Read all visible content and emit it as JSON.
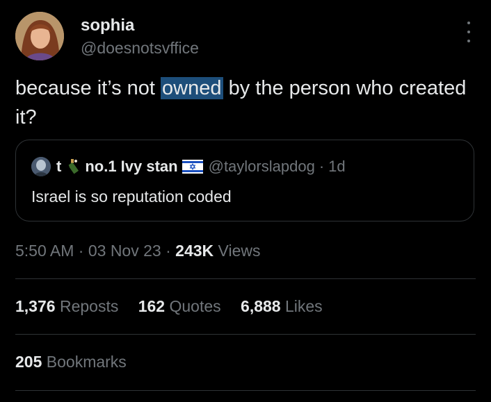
{
  "author": {
    "display_name": "sophia",
    "handle": "@doesnotsvffice"
  },
  "tweet": {
    "text_before": "because it’s not ",
    "text_highlight": "owned",
    "text_after": " by the person who created it?"
  },
  "quote": {
    "name_t": "t",
    "name_rest": "no.1 Ivy stan",
    "handle": "@taylorslapdog",
    "separator": "·",
    "time": "1d",
    "text": "Israel is so reputation coded"
  },
  "meta": {
    "time": "5:50 AM",
    "dot1": "·",
    "date": "03 Nov 23",
    "dot2": "·",
    "views_count": "243K",
    "views_label": "Views"
  },
  "stats": [
    {
      "count": "1,376",
      "label": "Reposts"
    },
    {
      "count": "162",
      "label": "Quotes"
    },
    {
      "count": "6,888",
      "label": "Likes"
    }
  ],
  "bookmarks": {
    "count": "205",
    "label": "Bookmarks"
  },
  "colors": {
    "background": "#000000",
    "text": "#e7e9ea",
    "muted": "#71767b",
    "highlight": "#1d4e7a",
    "border": "#2f3336"
  },
  "icons": [
    "more-icon",
    "wine-bottle-icon",
    "israel-flag-icon"
  ]
}
